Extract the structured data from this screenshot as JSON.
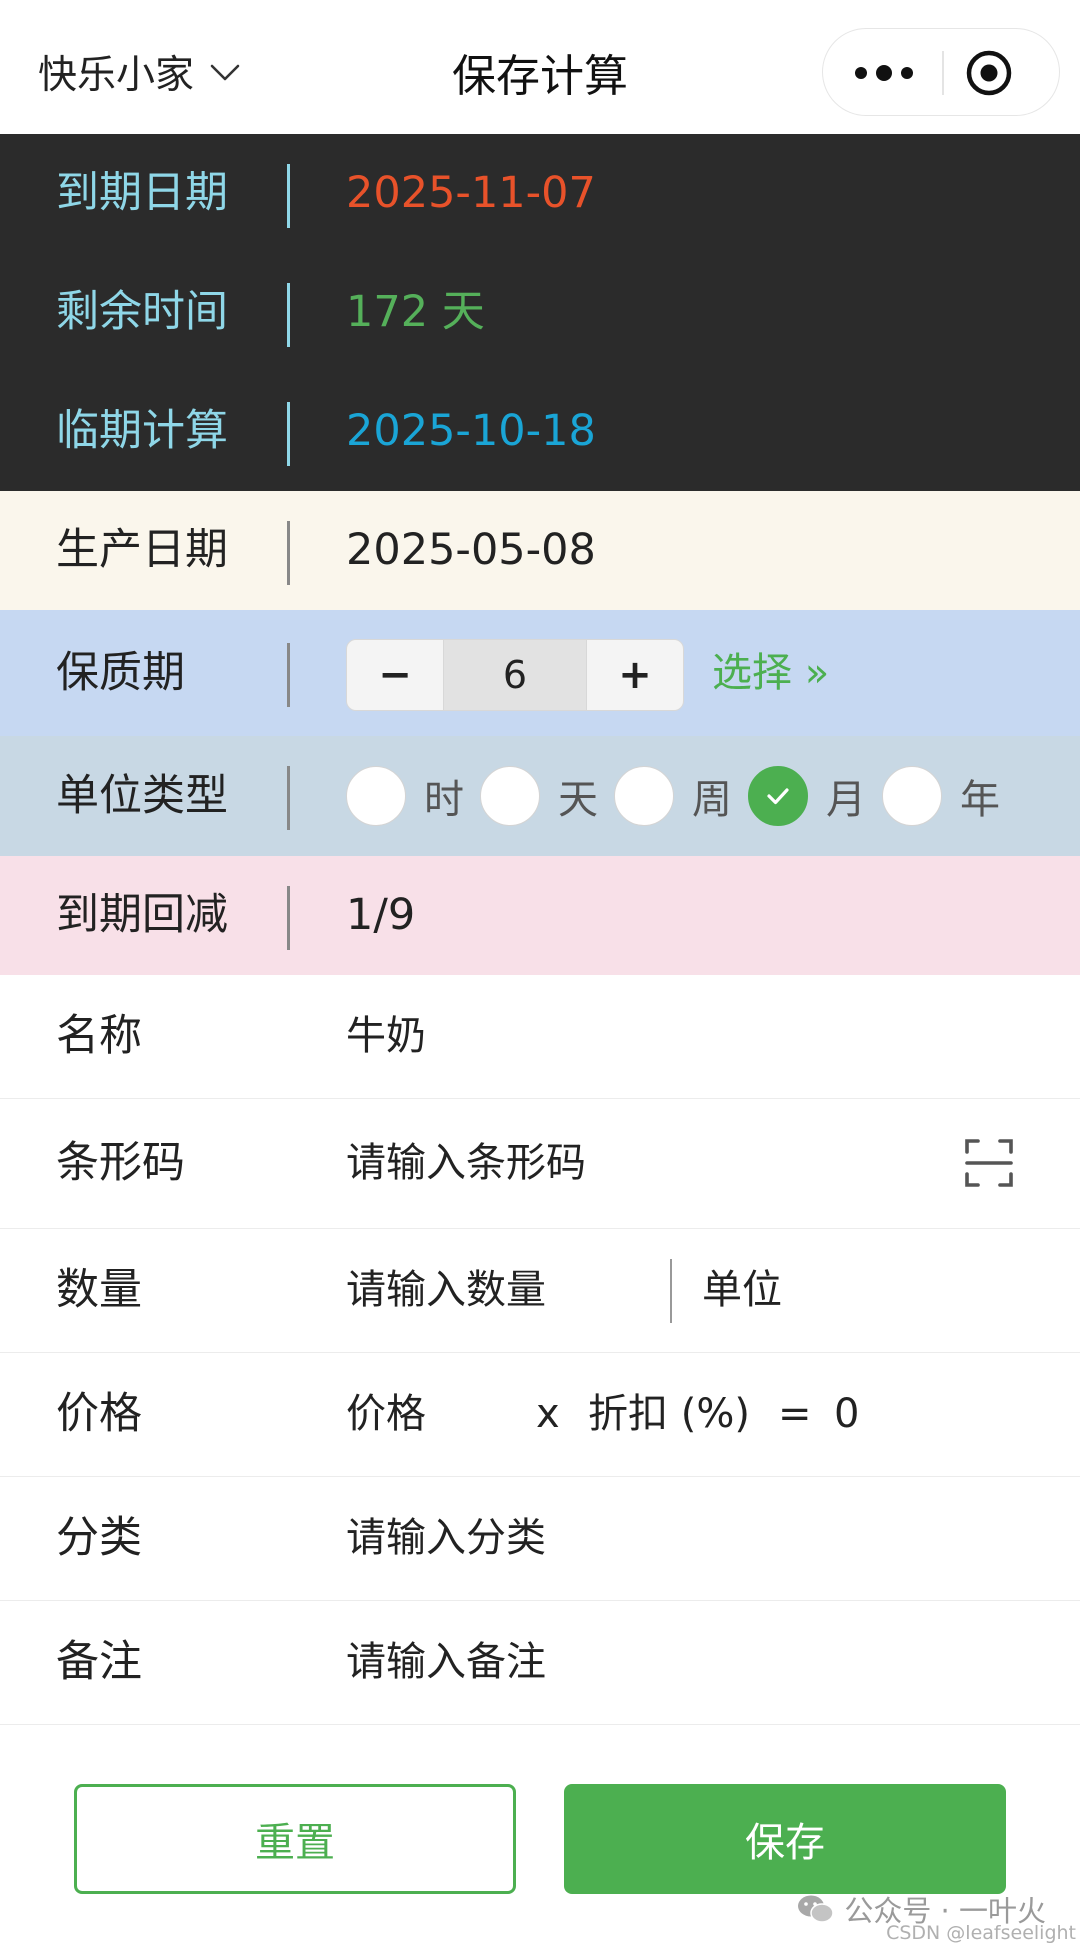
{
  "navbar": {
    "home_name": "快乐小家",
    "title": "保存计算"
  },
  "summary": {
    "expiry": {
      "label": "到期日期",
      "value": "2025-11-07",
      "color": "#e8522a"
    },
    "remaining": {
      "label": "剩余时间",
      "value": "172 天",
      "color": "#55b05a"
    },
    "near_expiry": {
      "label": "临期计算",
      "value": "2025-10-18",
      "color": "#1aa5d6"
    }
  },
  "production": {
    "label": "生产日期",
    "value": "2025-05-08"
  },
  "shelf_life": {
    "label": "保质期",
    "minus": "−",
    "value": "6",
    "plus": "+",
    "select_label": "选择 »"
  },
  "unit_type": {
    "label": "单位类型",
    "options": [
      {
        "label": "时",
        "selected": false
      },
      {
        "label": "天",
        "selected": false
      },
      {
        "label": "周",
        "selected": false
      },
      {
        "label": "月",
        "selected": true
      },
      {
        "label": "年",
        "selected": false
      }
    ]
  },
  "expiry_back": {
    "label": "到期回减",
    "value": "1/9"
  },
  "form": {
    "name": {
      "label": "名称",
      "value": "牛奶"
    },
    "barcode": {
      "label": "条形码",
      "placeholder": "请输入条形码"
    },
    "quantity": {
      "label": "数量",
      "placeholder": "请输入数量",
      "unit_placeholder": "单位"
    },
    "price": {
      "label": "价格",
      "placeholder": "价格",
      "times": "x",
      "discount_placeholder": "折扣 (%)",
      "equals": "=",
      "total": "0"
    },
    "category": {
      "label": "分类",
      "placeholder": "请输入分类"
    },
    "note": {
      "label": "备注",
      "placeholder": "请输入备注"
    }
  },
  "actions": {
    "reset_label": "重置",
    "save_label": "保存"
  },
  "watermark": {
    "line1": "公众号 · 一叶火",
    "line2": "CSDN @leafseelight"
  },
  "colors": {
    "accent": "#4caf50",
    "dark_band": "#2b2b2b",
    "label_cyan": "#8fd7e8"
  }
}
